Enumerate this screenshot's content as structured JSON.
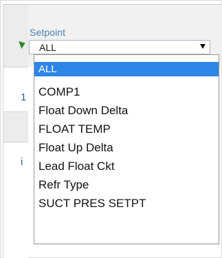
{
  "setpoint": {
    "label": "Setpoint",
    "selected_value": "ALL",
    "options": [
      "ALL",
      "COMP1",
      "Float Down Delta",
      "FLOAT TEMP",
      "Float Up Delta",
      "Lead Float Ckt",
      "Refr Type",
      "SUCT PRES SETPT"
    ]
  },
  "rows": [
    {
      "glyph": "1"
    },
    {
      "glyph": "i"
    }
  ],
  "colors": {
    "label": "#4a7fb0",
    "highlight": "#2f86e6",
    "marker": "#2e8b2e"
  }
}
